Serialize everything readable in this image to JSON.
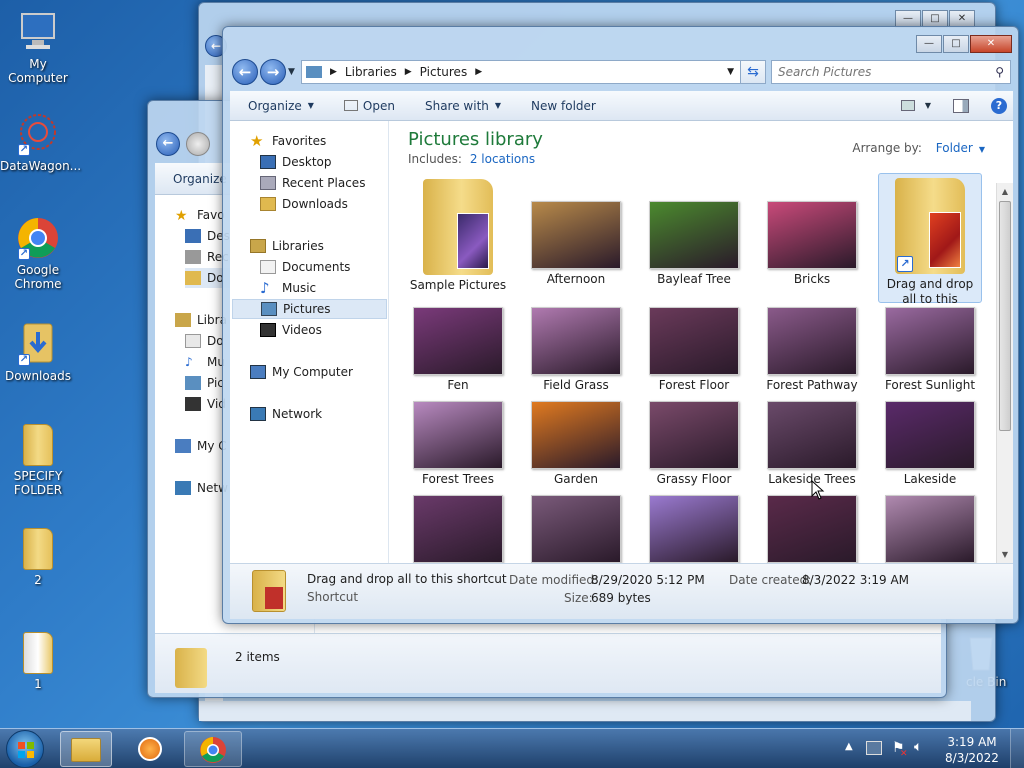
{
  "desktop_icons": [
    {
      "label": "My Computer",
      "icon": "computer-icon"
    },
    {
      "label": "DataWagon...",
      "icon": "app-shortcut-icon"
    },
    {
      "label": "Google Chrome",
      "icon": "chrome-icon"
    },
    {
      "label": "Downloads",
      "icon": "downloads-folder-icon"
    },
    {
      "label": "SPECIFY FOLDER",
      "icon": "folder-icon"
    },
    {
      "label": "2",
      "icon": "folder-icon"
    },
    {
      "label": "1",
      "icon": "folder-icon"
    },
    {
      "label": "cle Bin",
      "icon": "recycle-bin-icon"
    }
  ],
  "back_window": {
    "organize": "Organize",
    "nav": [
      "Favo",
      "Des",
      "Rec",
      "Do",
      "Libra",
      "Do",
      "Mu",
      "Pic",
      "Vid",
      "My C",
      "Netw"
    ],
    "status": "2 items"
  },
  "explorer": {
    "breadcrumb": [
      "Libraries",
      "Pictures"
    ],
    "search_placeholder": "Search Pictures",
    "toolbar": {
      "organize": "Organize",
      "open": "Open",
      "share": "Share with",
      "new_folder": "New folder"
    },
    "nav": {
      "favorites": "Favorites",
      "desktop": "Desktop",
      "recent": "Recent Places",
      "downloads": "Downloads",
      "libraries": "Libraries",
      "documents": "Documents",
      "music": "Music",
      "pictures": "Pictures",
      "videos": "Videos",
      "mycomputer": "My Computer",
      "network": "Network"
    },
    "library_title": "Pictures library",
    "includes_label": "Includes:",
    "includes_link": "2 locations",
    "arrange_label": "Arrange by:",
    "arrange_value": "Folder",
    "items": [
      {
        "label": "Sample Pictures",
        "kind": "folder"
      },
      {
        "label": "Afternoon",
        "kind": "photo",
        "color": "#b88a4a"
      },
      {
        "label": "Bayleaf Tree",
        "kind": "photo",
        "color": "#4b8a2e"
      },
      {
        "label": "Bricks",
        "kind": "photo",
        "color": "#c94a7a"
      },
      {
        "label": "Drag and drop all to this shortcut",
        "kind": "shortcut"
      },
      {
        "label": "Fen",
        "kind": "photo",
        "color": "#7a3a7a"
      },
      {
        "label": "Field Grass",
        "kind": "photo",
        "color": "#b07ab0"
      },
      {
        "label": "Forest Floor",
        "kind": "photo",
        "color": "#6a3a5a"
      },
      {
        "label": "Forest Pathway",
        "kind": "photo",
        "color": "#8a5a8a"
      },
      {
        "label": "Forest Sunlight",
        "kind": "photo",
        "color": "#9a6aa0"
      },
      {
        "label": "Forest Trees",
        "kind": "photo",
        "color": "#b88ac0"
      },
      {
        "label": "Garden",
        "kind": "photo",
        "color": "#e07a20"
      },
      {
        "label": "Grassy Floor",
        "kind": "photo",
        "color": "#7a4a6a"
      },
      {
        "label": "Lakeside Trees",
        "kind": "photo",
        "color": "#6a4a6a"
      },
      {
        "label": "Lakeside",
        "kind": "photo",
        "color": "#5a2a6a"
      },
      {
        "label": "",
        "kind": "photo",
        "color": "#6a3a6a"
      },
      {
        "label": "",
        "kind": "photo",
        "color": "#7a5a7a"
      },
      {
        "label": "",
        "kind": "photo",
        "color": "#9a7ad0"
      },
      {
        "label": "",
        "kind": "photo",
        "color": "#5a2a4a"
      },
      {
        "label": "",
        "kind": "photo",
        "color": "#b08ab0"
      }
    ],
    "details": {
      "name": "Drag and drop all to this shortcut",
      "type": "Shortcut",
      "modified_label": "Date modified:",
      "modified_value": "8/29/2020 5:12 PM",
      "created_label": "Date created:",
      "created_value": "8/3/2022 3:19 AM",
      "size_label": "Size:",
      "size_value": "689 bytes"
    }
  },
  "taskbar": {
    "time": "3:19 AM",
    "date": "8/3/2022"
  }
}
